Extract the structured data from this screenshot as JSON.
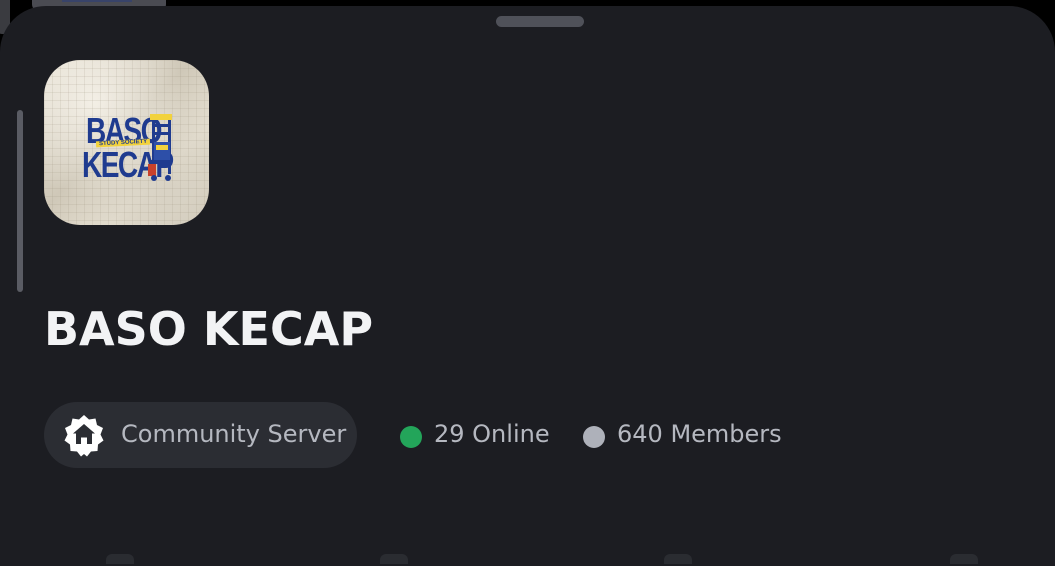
{
  "server": {
    "name": "BASO KECAP",
    "icon": {
      "name": "server-logo",
      "logo_lines": [
        "BASO",
        "KECAP"
      ],
      "logo_tagline": "STUDY SOCIETY"
    }
  },
  "badges": {
    "community": {
      "icon": "home-badge-icon",
      "label": "Community Server"
    }
  },
  "stats": {
    "online": {
      "label": "29 Online",
      "color": "#23a55a"
    },
    "members": {
      "label": "640 Members",
      "color": "#aeb1ba"
    }
  },
  "theme": {
    "sheet_background": "#1c1d22",
    "pill_background": "#2b2d33",
    "text_primary": "#f2f3f5",
    "text_secondary": "#b5b8c0"
  }
}
